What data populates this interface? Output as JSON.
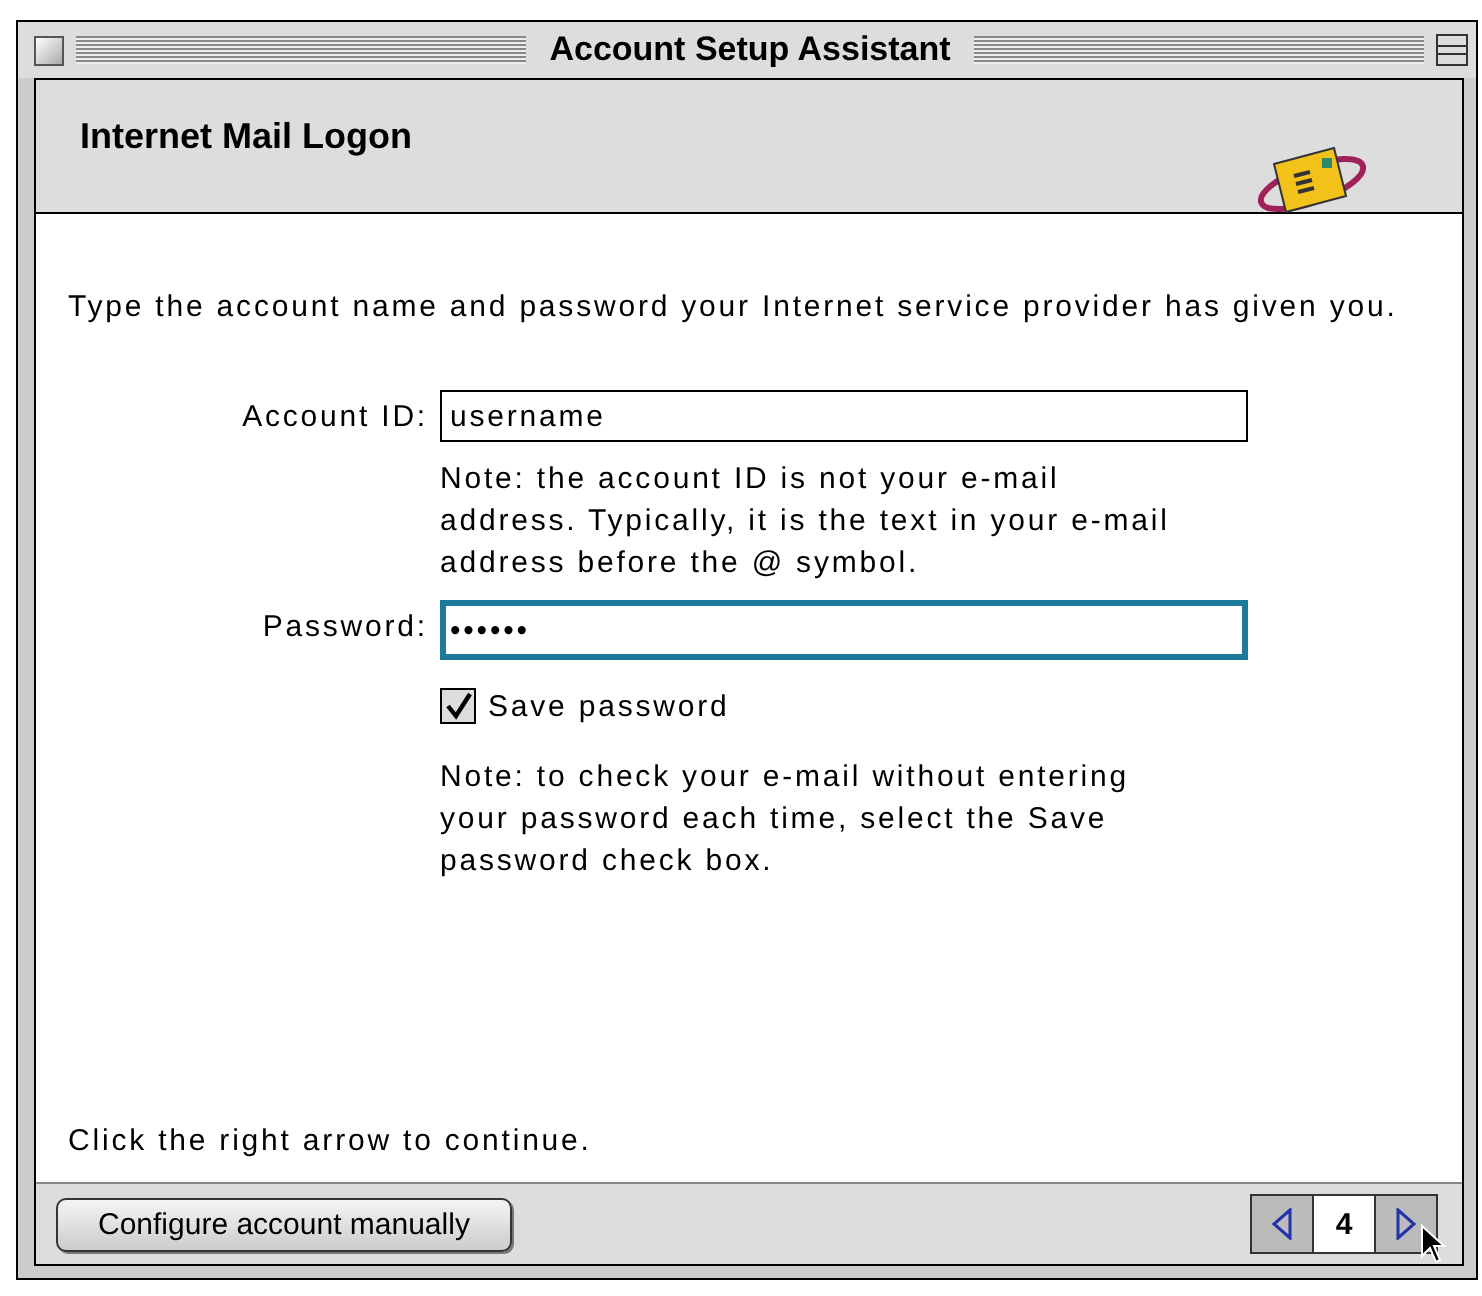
{
  "window": {
    "title": "Account Setup Assistant"
  },
  "header": {
    "title": "Internet Mail Logon"
  },
  "intro": "Type the account name and password your Internet service provider has given you.",
  "fields": [
    {
      "label": "Account ID:",
      "value": "username",
      "focused": false,
      "note": "Note: the account ID is not your e-mail address. Typically, it is the text in your e-mail address before the @ symbol."
    },
    {
      "label": "Password:",
      "value": "••••••",
      "focused": true
    }
  ],
  "save_password": {
    "label": "Save password",
    "checked": true
  },
  "save_note": "Note: to check your e-mail without entering your password each time, select the Save password check box.",
  "instruction": "Click the right arrow to continue.",
  "footer": {
    "button": "Configure account manually",
    "page": "4"
  }
}
